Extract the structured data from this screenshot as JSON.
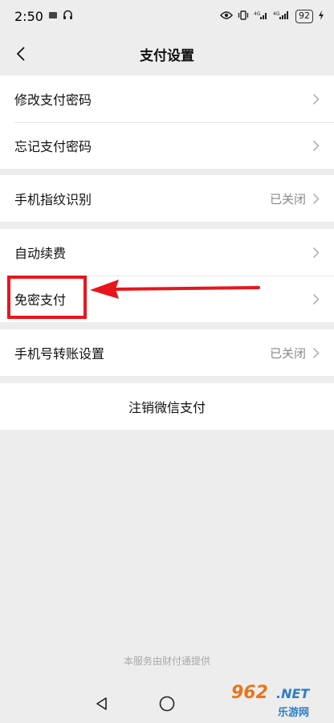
{
  "status_bar": {
    "time": "2:50",
    "battery": "92",
    "icons": [
      "notification-icon",
      "headphones-icon",
      "eye-icon",
      "vibrate-icon",
      "signal-4g-icon",
      "signal-4g-2-icon",
      "charging-icon"
    ]
  },
  "header": {
    "title": "支付设置"
  },
  "groups": {
    "password": {
      "change_label": "修改支付密码",
      "forgot_label": "忘记支付密码"
    },
    "fingerprint": {
      "label": "手机指纹识别",
      "value": "已关闭"
    },
    "renewal": {
      "auto_label": "自动续费",
      "nopw_label": "免密支付"
    },
    "phone_transfer": {
      "label": "手机号转账设置",
      "value": "已关闭"
    },
    "deregister": {
      "label": "注销微信支付"
    }
  },
  "footer": {
    "provider": "本服务由财付通提供"
  },
  "annotation": {
    "highlight_color": "#e8161b"
  },
  "watermark": {
    "number": "962",
    "domain": ".NET",
    "name": "乐游网"
  }
}
